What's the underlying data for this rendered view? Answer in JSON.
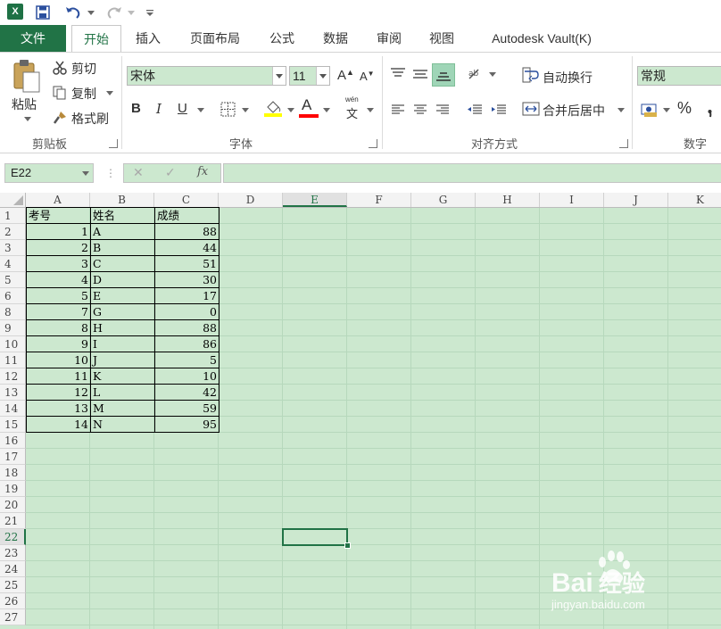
{
  "title_bar": {
    "app_logo_text": "X",
    "icons": [
      "excel-logo-icon",
      "save-icon",
      "undo-icon",
      "redo-icon",
      "customize-qat-icon"
    ]
  },
  "tabs": [
    {
      "name": "file",
      "label": "文件"
    },
    {
      "name": "home",
      "label": "开始",
      "active": true
    },
    {
      "name": "insert",
      "label": "插入"
    },
    {
      "name": "page-layout",
      "label": "页面布局"
    },
    {
      "name": "formulas",
      "label": "公式"
    },
    {
      "name": "data",
      "label": "数据"
    },
    {
      "name": "review",
      "label": "审阅"
    },
    {
      "name": "view",
      "label": "视图"
    },
    {
      "name": "autodesk-vault",
      "label": "Autodesk Vault(K)"
    }
  ],
  "ribbon": {
    "clipboard": {
      "paste_label": "粘贴",
      "cut_label": "剪切",
      "copy_label": "复制",
      "format_painter_label": "格式刷",
      "group_label": "剪贴板"
    },
    "font": {
      "font_name": "宋体",
      "font_size": "11",
      "bold": "B",
      "italic": "I",
      "underline": "U",
      "font_color_glyph": "A",
      "grow_glyph": "A",
      "shrink_glyph": "A",
      "phonetic_top": "wén",
      "phonetic_bottom": "文",
      "group_label": "字体"
    },
    "alignment": {
      "wrap_text_label": "自动换行",
      "merge_center_label": "合并后居中",
      "group_label": "对齐方式"
    },
    "number": {
      "format_value": "常规",
      "percent": "%",
      "group_label": "数字"
    }
  },
  "formula_bar": {
    "name_box": "E22",
    "cancel_glyph": "✕",
    "enter_glyph": "✓",
    "fx_label": "fx",
    "formula_value": ""
  },
  "sheet": {
    "columns": [
      "A",
      "B",
      "C",
      "D",
      "E",
      "F",
      "G",
      "H",
      "I",
      "J",
      "K"
    ],
    "active_column": "E",
    "rows": [
      "1",
      "2",
      "3",
      "4",
      "5",
      "6",
      "8",
      "9",
      "10",
      "11",
      "12",
      "13",
      "14",
      "15",
      "16",
      "17",
      "18",
      "19",
      "20",
      "21",
      "22",
      "23",
      "24",
      "25",
      "26",
      "27"
    ],
    "active_row": "22",
    "table": {
      "header": [
        "考号",
        "姓名",
        "成绩"
      ],
      "records": [
        [
          "1",
          "A",
          "88"
        ],
        [
          "2",
          "B",
          "44"
        ],
        [
          "3",
          "C",
          "51"
        ],
        [
          "4",
          "D",
          "30"
        ],
        [
          "5",
          "E",
          "17"
        ],
        [
          "7",
          "G",
          "0"
        ],
        [
          "8",
          "H",
          "88"
        ],
        [
          "9",
          "I",
          "86"
        ],
        [
          "10",
          "J",
          "5"
        ],
        [
          "11",
          "K",
          "10"
        ],
        [
          "12",
          "L",
          "42"
        ],
        [
          "13",
          "M",
          "59"
        ],
        [
          "14",
          "N",
          "95"
        ]
      ]
    },
    "selected_cell": "E22"
  },
  "watermark": {
    "brand": "Bai",
    "brand_suffix": "经验",
    "url": "jingyan.baidu.com"
  },
  "colors": {
    "excel_green": "#217346",
    "cell_background": "#cce8cf",
    "header_background": "#f3f3f3",
    "fill_highlight": "#ffff00",
    "font_color_red": "#ff0000"
  }
}
